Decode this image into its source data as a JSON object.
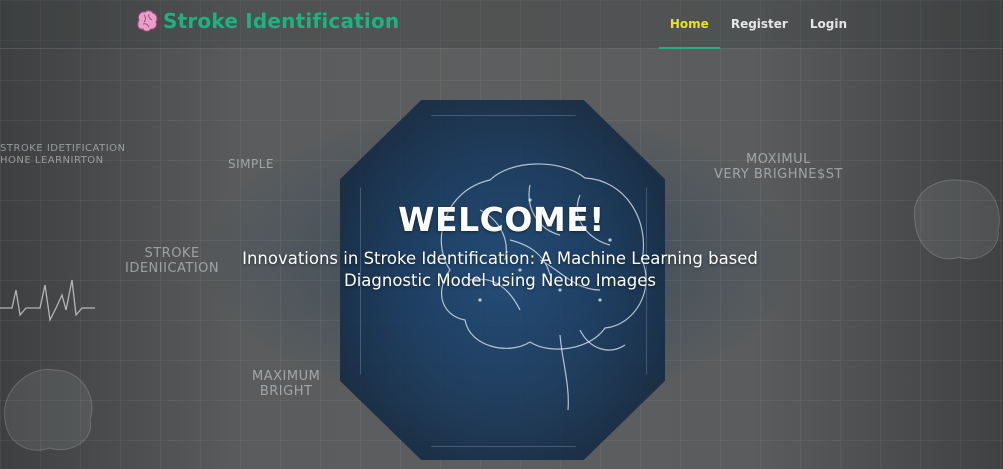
{
  "brand": {
    "name": "Stroke Identification",
    "icon": "brain-icon"
  },
  "nav": {
    "items": [
      {
        "label": "Home",
        "active": true
      },
      {
        "label": "Register",
        "active": false
      },
      {
        "label": "Login",
        "active": false
      }
    ]
  },
  "hero": {
    "heading": "WELCOME!",
    "subtitle": "Innovations in Stroke Identification: A Machine Learning based Diagnostic Model using Neuro Images"
  },
  "background_art": {
    "labels": [
      "STROKE IDETIFICATION\nHONE LEARNIRTON",
      "SIMPLE",
      "STROKE\nIDENIICATION",
      "MAXIMUM\nBRIGHT",
      "MOXIMUL\nVERY BRIGHNE$ST"
    ]
  },
  "colors": {
    "brand": "#1bb37f",
    "nav_active": "#e8e22b",
    "nav_text": "#e6e6e6",
    "background": "#4a4c4d"
  }
}
